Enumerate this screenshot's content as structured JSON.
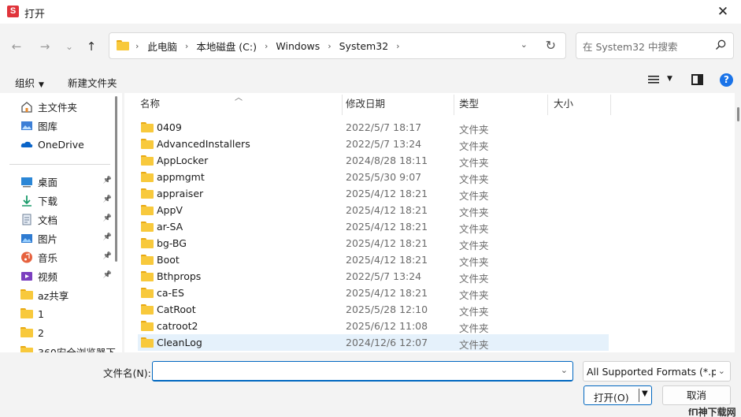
{
  "window": {
    "title": "打开",
    "app_icon_letter": "S"
  },
  "nav": {
    "back": "←",
    "forward": "→",
    "recent": "⌄",
    "up": "↑"
  },
  "breadcrumb": [
    "此电脑",
    "本地磁盘 (C:)",
    "Windows",
    "System32"
  ],
  "search": {
    "placeholder": "在 System32 中搜索"
  },
  "toolbar": {
    "organize": "组织",
    "new_folder": "新建文件夹"
  },
  "sidebar": {
    "quick": [
      {
        "label": "主文件夹",
        "icon": "home-icon"
      },
      {
        "label": "图库",
        "icon": "gallery-icon"
      },
      {
        "label": "OneDrive",
        "icon": "onedrive-icon"
      }
    ],
    "pinned": [
      {
        "label": "桌面",
        "icon": "desktop-icon",
        "pinned": true
      },
      {
        "label": "下载",
        "icon": "download-icon",
        "pinned": true
      },
      {
        "label": "文档",
        "icon": "documents-icon",
        "pinned": true
      },
      {
        "label": "图片",
        "icon": "pictures-icon",
        "pinned": true
      },
      {
        "label": "音乐",
        "icon": "music-icon",
        "pinned": true
      },
      {
        "label": "视频",
        "icon": "videos-icon",
        "pinned": true
      },
      {
        "label": "az共享",
        "icon": "folder-icon",
        "pinned": false
      },
      {
        "label": "1",
        "icon": "folder-icon",
        "pinned": false
      },
      {
        "label": "2",
        "icon": "folder-icon",
        "pinned": false
      },
      {
        "label": "360安全浏览器下",
        "icon": "folder-icon",
        "pinned": false
      }
    ]
  },
  "columns": {
    "name": "名称",
    "date": "修改日期",
    "type": "类型",
    "size": "大小"
  },
  "files": [
    {
      "name": "0409",
      "date": "2022/5/7 18:17",
      "type": "文件夹"
    },
    {
      "name": "AdvancedInstallers",
      "date": "2022/5/7 13:24",
      "type": "文件夹"
    },
    {
      "name": "AppLocker",
      "date": "2024/8/28 18:11",
      "type": "文件夹"
    },
    {
      "name": "appmgmt",
      "date": "2025/5/30 9:07",
      "type": "文件夹"
    },
    {
      "name": "appraiser",
      "date": "2025/4/12 18:21",
      "type": "文件夹"
    },
    {
      "name": "AppV",
      "date": "2025/4/12 18:21",
      "type": "文件夹"
    },
    {
      "name": "ar-SA",
      "date": "2025/4/12 18:21",
      "type": "文件夹"
    },
    {
      "name": "bg-BG",
      "date": "2025/4/12 18:21",
      "type": "文件夹"
    },
    {
      "name": "Boot",
      "date": "2025/4/12 18:21",
      "type": "文件夹"
    },
    {
      "name": "Bthprops",
      "date": "2022/5/7 13:24",
      "type": "文件夹"
    },
    {
      "name": "ca-ES",
      "date": "2025/4/12 18:21",
      "type": "文件夹"
    },
    {
      "name": "CatRoot",
      "date": "2025/5/28 12:10",
      "type": "文件夹"
    },
    {
      "name": "catroot2",
      "date": "2025/6/12 11:08",
      "type": "文件夹"
    },
    {
      "name": "CleanLog",
      "date": "2024/12/6 12:07",
      "type": "文件夹"
    }
  ],
  "selected_index": 13,
  "bottom": {
    "filename_label": "文件名(N):",
    "filename_value": "",
    "filter": "All Supported Formats (*.pd",
    "open": "打开(O)",
    "cancel": "取消"
  },
  "watermark": "fΠ神下载网",
  "colors": {
    "accent": "#0067c0",
    "selected_row": "#e5f1fb",
    "folder": "#f8c93c",
    "app_icon": "#e0343b"
  }
}
